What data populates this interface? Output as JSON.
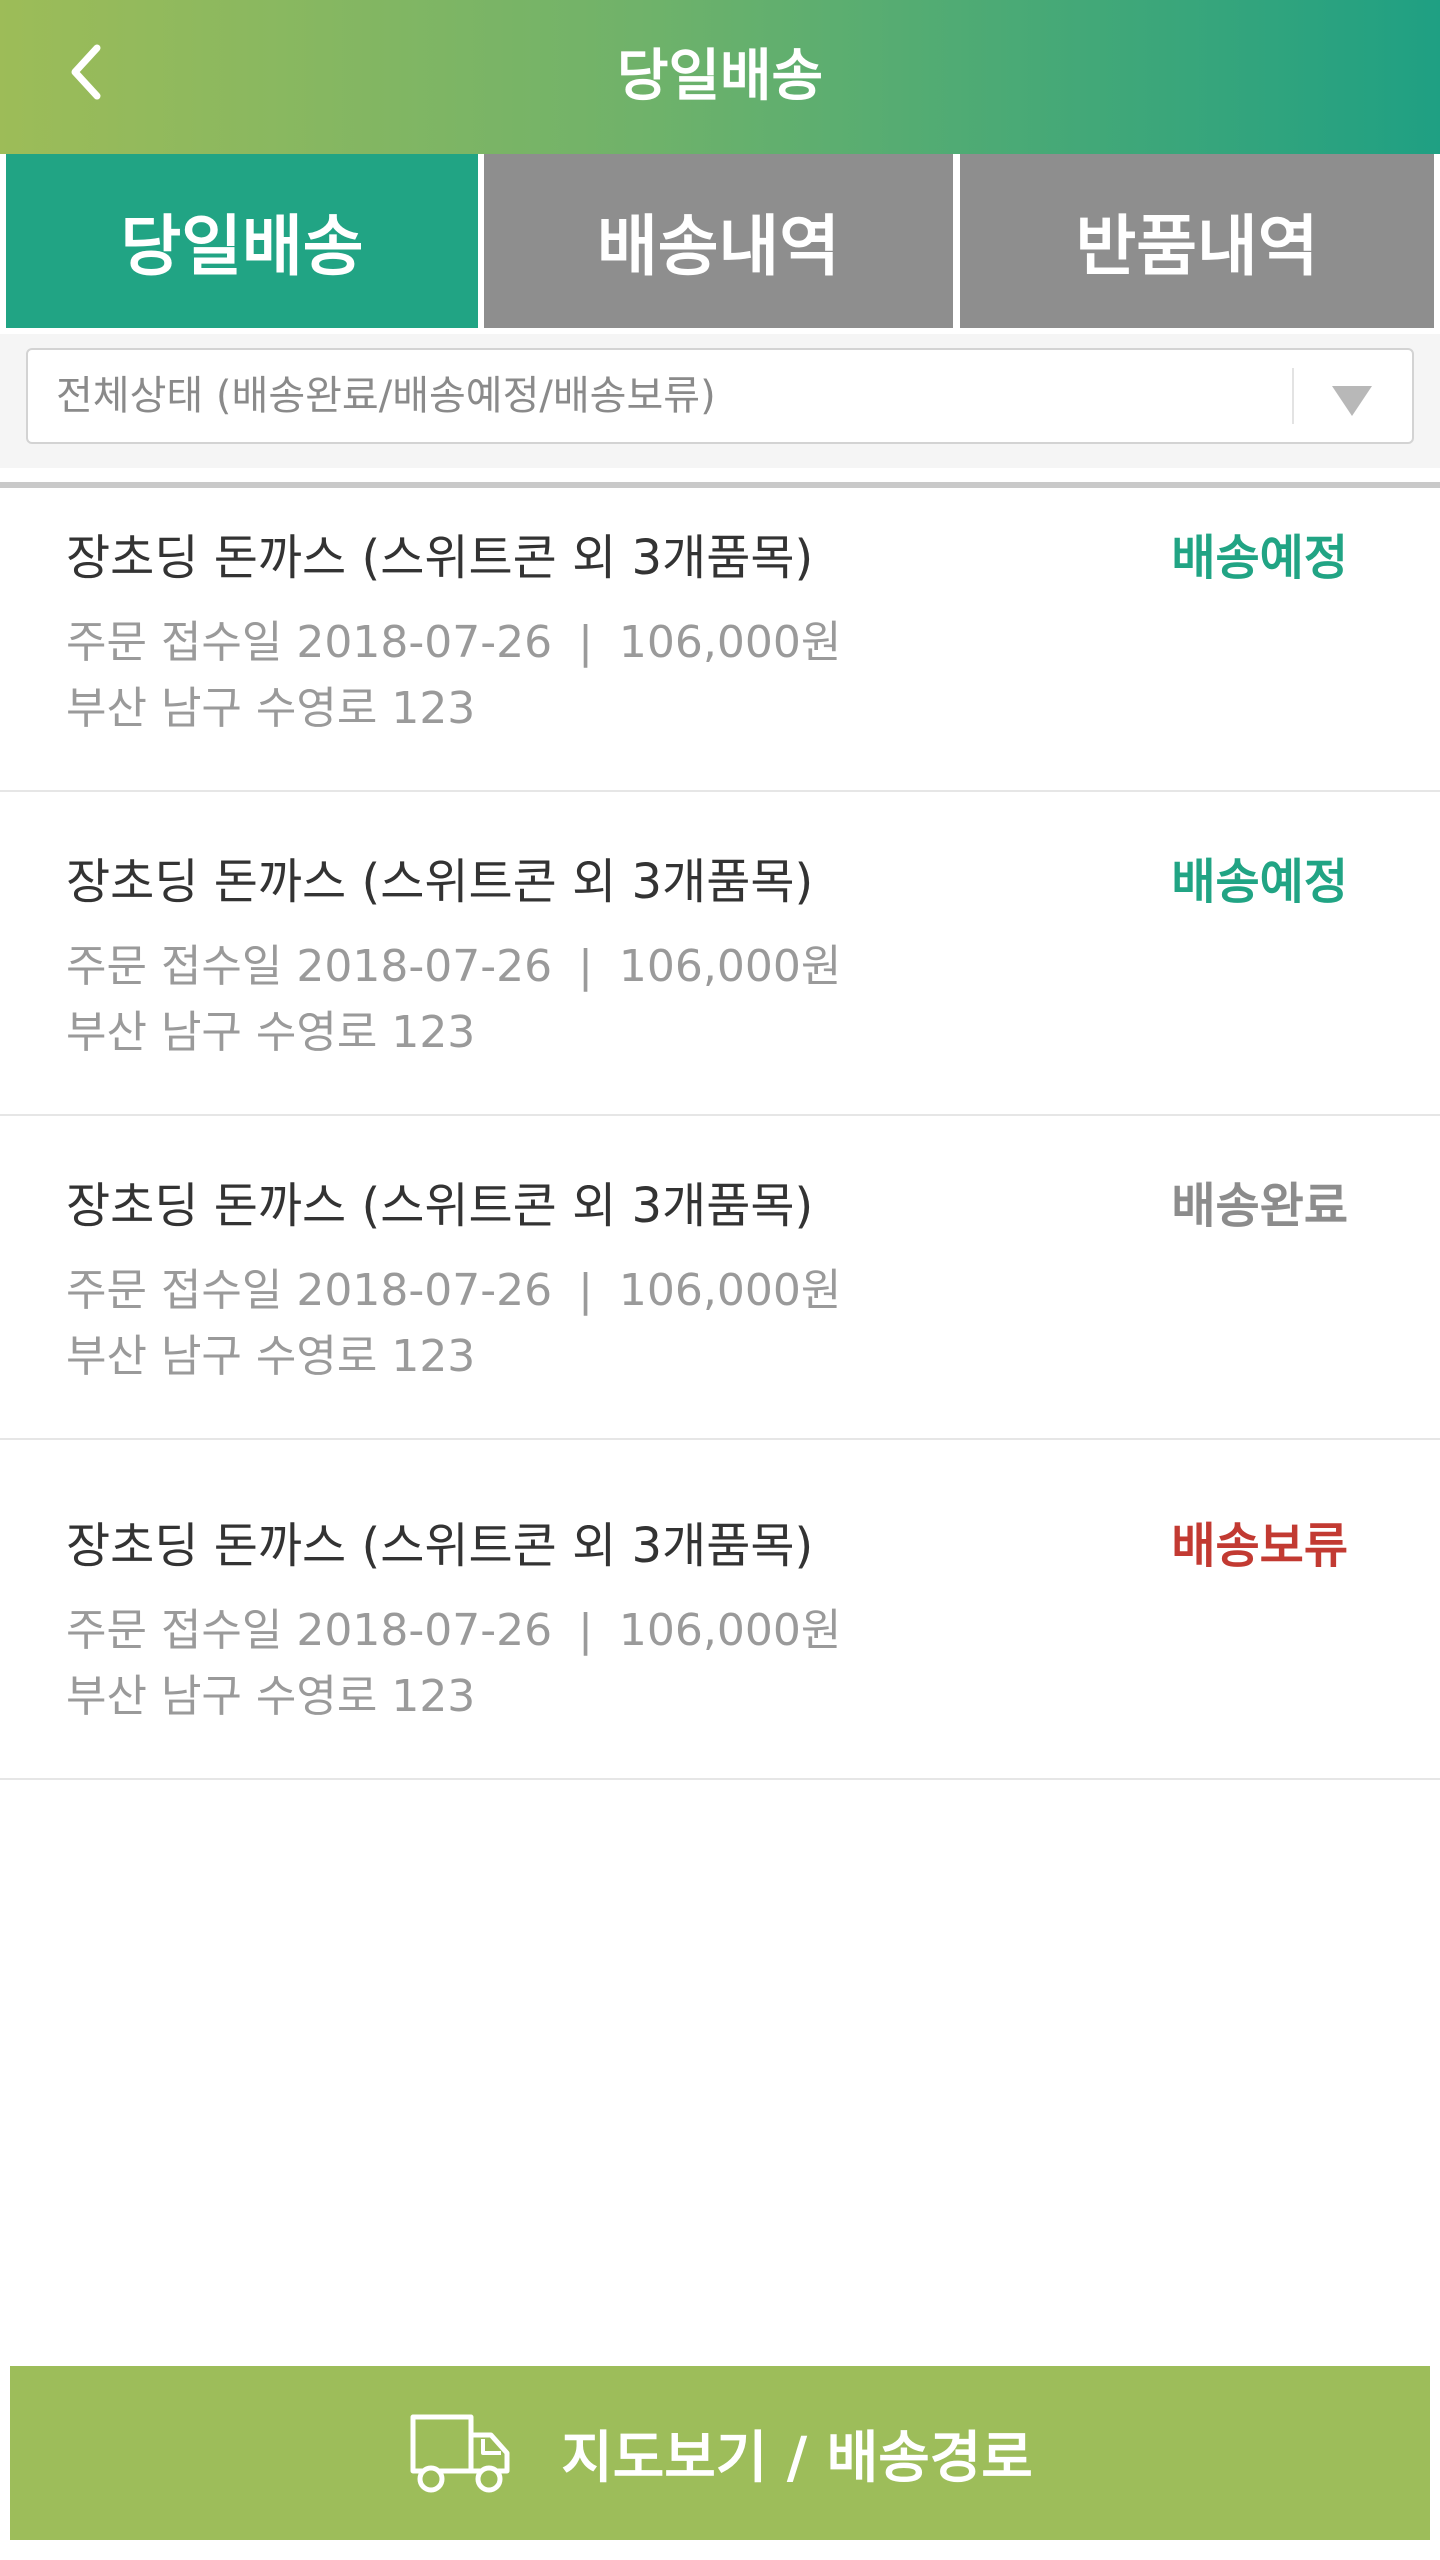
{
  "header": {
    "title": "당일배송"
  },
  "tabs": [
    {
      "label": "당일배송"
    },
    {
      "label": "배송내역"
    },
    {
      "label": "반품내역"
    }
  ],
  "filter": {
    "value": "전체상태 (배송완료/배송예정/배송보류)"
  },
  "orders": [
    {
      "title": "장초딩 돈까스 (스위트콘 외 3개품목)",
      "status": "배송예정",
      "status_color": "#21a484",
      "date": "주문 접수일 2018-07-26",
      "separator": "|",
      "amount": "106,000원",
      "address": "부산 남구 수영로 123"
    },
    {
      "title": "장초딩 돈까스 (스위트콘 외 3개품목)",
      "status": "배송예정",
      "status_color": "#21a484",
      "date": "주문 접수일 2018-07-26",
      "separator": "|",
      "amount": "106,000원",
      "address": "부산 남구 수영로 123"
    },
    {
      "title": "장초딩 돈까스 (스위트콘 외 3개품목)",
      "status": "배송완료",
      "status_color": "#8c8c8c",
      "date": "주문 접수일 2018-07-26",
      "separator": "|",
      "amount": "106,000원",
      "address": "부산 남구 수영로 123"
    },
    {
      "title": "장초딩 돈까스 (스위트콘 외 3개품목)",
      "status": "배송보류",
      "status_color": "#c23a32",
      "date": "주문 접수일 2018-07-26",
      "separator": "|",
      "amount": "106,000원",
      "address": "부산 남구 수영로 123"
    }
  ],
  "bottom_button": {
    "icon": "truck-icon",
    "label": "지도보기 / 배송경로"
  }
}
